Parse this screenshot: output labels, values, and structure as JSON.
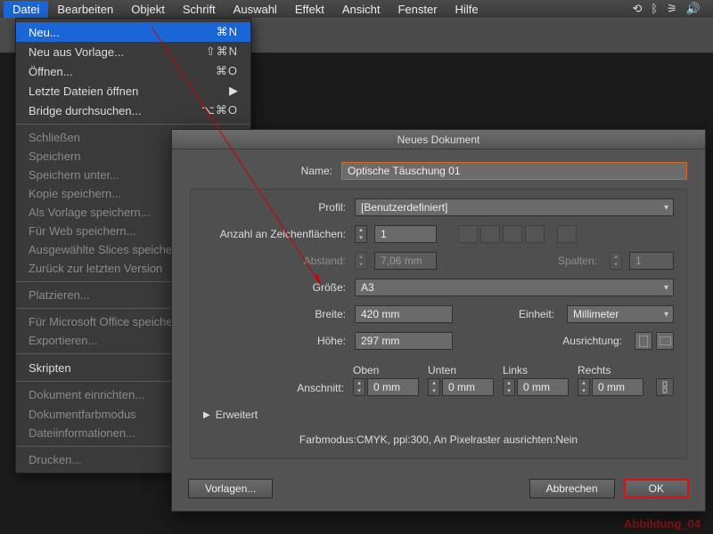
{
  "menubar": {
    "items": [
      "Datei",
      "Bearbeiten",
      "Objekt",
      "Schrift",
      "Auswahl",
      "Effekt",
      "Ansicht",
      "Fenster",
      "Hilfe"
    ],
    "active_index": 0
  },
  "dropdown": {
    "groups": [
      [
        {
          "label": "Neu...",
          "shortcut": "⌘N",
          "hi": true
        },
        {
          "label": "Neu aus Vorlage...",
          "shortcut": "⇧⌘N"
        },
        {
          "label": "Öffnen...",
          "shortcut": "⌘O"
        },
        {
          "label": "Letzte Dateien öffnen",
          "submenu": true
        },
        {
          "label": "Bridge durchsuchen...",
          "shortcut": "⌥⌘O"
        }
      ],
      [
        {
          "label": "Schließen",
          "disabled": true
        },
        {
          "label": "Speichern",
          "disabled": true
        },
        {
          "label": "Speichern unter...",
          "disabled": true
        },
        {
          "label": "Kopie speichern...",
          "disabled": true
        },
        {
          "label": "Als Vorlage speichern...",
          "disabled": true
        },
        {
          "label": "Für Web speichern...",
          "disabled": true
        },
        {
          "label": "Ausgewählte Slices speichern...",
          "disabled": true
        },
        {
          "label": "Zurück zur letzten Version",
          "disabled": true
        }
      ],
      [
        {
          "label": "Platzieren...",
          "disabled": true
        }
      ],
      [
        {
          "label": "Für Microsoft Office speichern...",
          "disabled": true
        },
        {
          "label": "Exportieren...",
          "disabled": true
        }
      ],
      [
        {
          "label": "Skripten",
          "submenu": true
        }
      ],
      [
        {
          "label": "Dokument einrichten...",
          "disabled": true
        },
        {
          "label": "Dokumentfarbmodus",
          "disabled": true,
          "submenu": true
        },
        {
          "label": "Dateiinformationen...",
          "disabled": true
        }
      ],
      [
        {
          "label": "Drucken...",
          "disabled": true
        }
      ]
    ]
  },
  "dialog": {
    "title": "Neues Dokument",
    "name_label": "Name:",
    "name_value": "Optische Täuschung 01",
    "profile_label": "Profil:",
    "profile_value": "[Benutzerdefiniert]",
    "artboards_label": "Anzahl an Zeichenflächen:",
    "artboards_value": "1",
    "spacing_label": "Abstand:",
    "spacing_value": "7,06 mm",
    "columns_label": "Spalten:",
    "columns_value": "1",
    "size_label": "Größe:",
    "size_value": "A3",
    "width_label": "Breite:",
    "width_value": "420 mm",
    "height_label": "Höhe:",
    "height_value": "297 mm",
    "units_label": "Einheit:",
    "units_value": "Millimeter",
    "orient_label": "Ausrichtung:",
    "bleed_label": "Anschnitt:",
    "bleed_headers": [
      "Oben",
      "Unten",
      "Links",
      "Rechts"
    ],
    "bleed_values": [
      "0 mm",
      "0 mm",
      "0 mm",
      "0 mm"
    ],
    "advanced_label": "Erweitert",
    "summary": "Farbmodus:CMYK, ppi:300, An Pixelraster ausrichten:Nein",
    "templates_btn": "Vorlagen...",
    "cancel_btn": "Abbrechen",
    "ok_btn": "OK"
  },
  "caption": "Abbildung_04"
}
